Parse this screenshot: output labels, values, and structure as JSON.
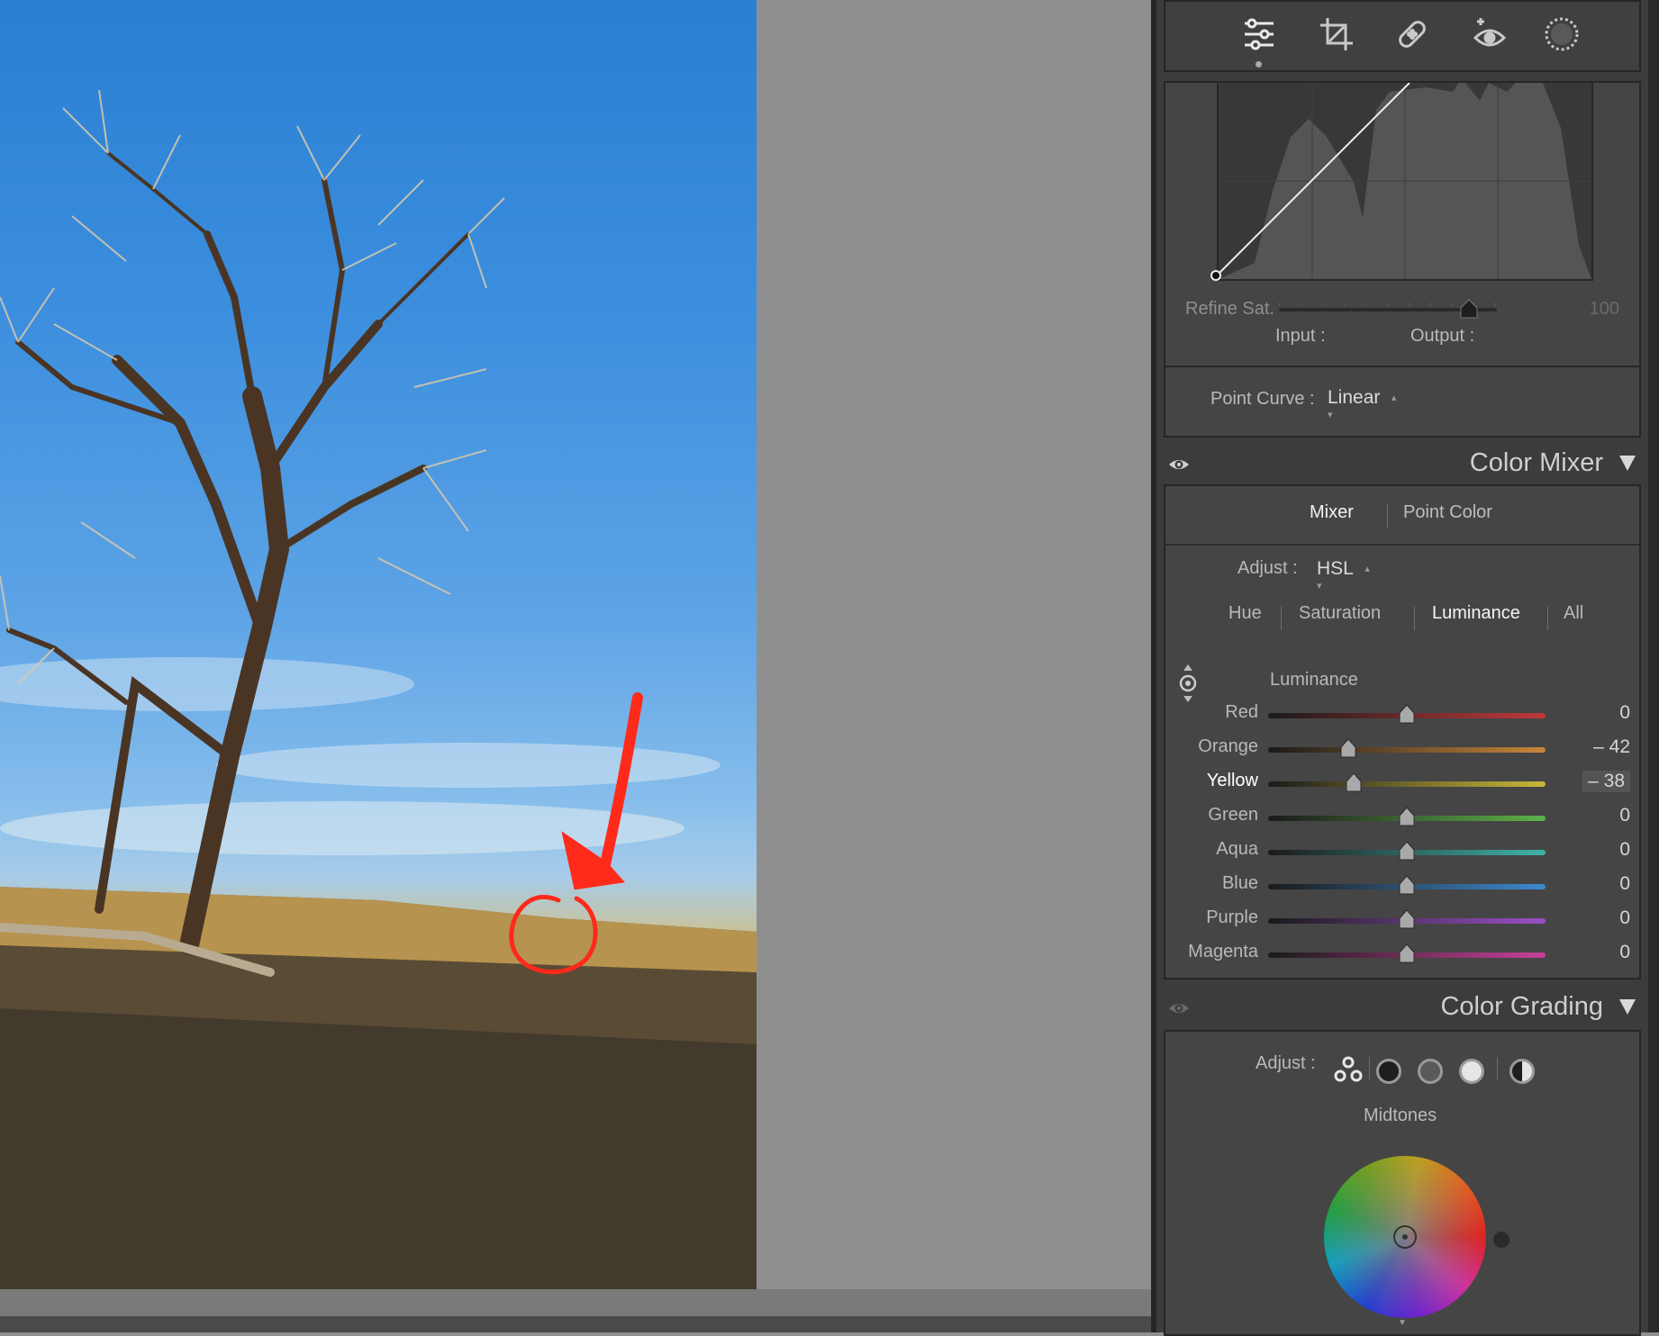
{
  "toolbar": {
    "tools": [
      {
        "icon": "edit-sliders-icon",
        "active": true
      },
      {
        "icon": "crop-icon"
      },
      {
        "icon": "healing-bandage-icon"
      },
      {
        "icon": "red-eye-icon"
      },
      {
        "icon": "masking-icon"
      }
    ]
  },
  "tone_curve": {
    "refine_sat_label": "Refine Sat.",
    "refine_sat_value": "100",
    "input_label": "Input :",
    "output_label": "Output :",
    "point_curve_label": "Point Curve :",
    "point_curve_value": "Linear"
  },
  "color_mixer": {
    "title": "Color Mixer",
    "tabs": [
      "Mixer",
      "Point Color"
    ],
    "active_tab": "Mixer",
    "adjust_label": "Adjust :",
    "adjust_value": "HSL",
    "modes": [
      "Hue",
      "Saturation",
      "Luminance",
      "All"
    ],
    "active_mode": "Luminance",
    "group_label": "Luminance",
    "sliders": [
      {
        "name": "Red",
        "value": "0",
        "level": 0,
        "color": "#c0393b"
      },
      {
        "name": "Orange",
        "value": "– 42",
        "level": -42,
        "color": "#c8863a"
      },
      {
        "name": "Yellow",
        "value": "– 38",
        "level": -38,
        "color": "#c8b83a",
        "active": true
      },
      {
        "name": "Green",
        "value": "0",
        "level": 0,
        "color": "#5fb34a"
      },
      {
        "name": "Aqua",
        "value": "0",
        "level": 0,
        "color": "#3fb3a8"
      },
      {
        "name": "Blue",
        "value": "0",
        "level": 0,
        "color": "#3d8ad0"
      },
      {
        "name": "Purple",
        "value": "0",
        "level": 0,
        "color": "#9b4fc8"
      },
      {
        "name": "Magenta",
        "value": "0",
        "level": 0,
        "color": "#c8409a"
      }
    ]
  },
  "color_grading": {
    "title": "Color Grading",
    "adjust_label": "Adjust :",
    "wheel_label": "Midtones"
  },
  "annotation": {
    "color": "#ff2a1a"
  }
}
